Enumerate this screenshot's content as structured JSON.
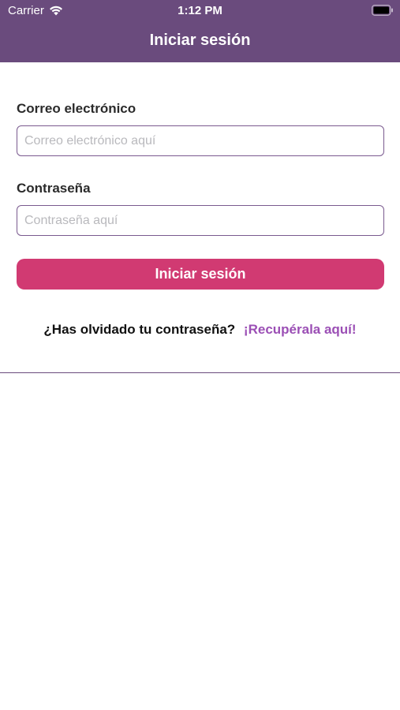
{
  "status_bar": {
    "carrier": "Carrier",
    "time": "1:12 PM",
    "wifi_icon": "wifi-icon",
    "battery_icon": "battery-icon"
  },
  "nav": {
    "title": "Iniciar sesión"
  },
  "form": {
    "email_label": "Correo electrónico",
    "email_placeholder": "Correo electrónico aquí",
    "email_value": "",
    "password_label": "Contraseña",
    "password_placeholder": "Contraseña aquí",
    "password_value": "",
    "login_button_label": "Iniciar sesión"
  },
  "forgot": {
    "question": "¿Has olvidado tu contraseña?",
    "link_label": "¡Recupérala aquí!"
  },
  "colors": {
    "header_bg": "#6a4b7d",
    "button_bg": "#d13a72",
    "link": "#9b4fb5",
    "input_border": "#7a5a8f"
  }
}
